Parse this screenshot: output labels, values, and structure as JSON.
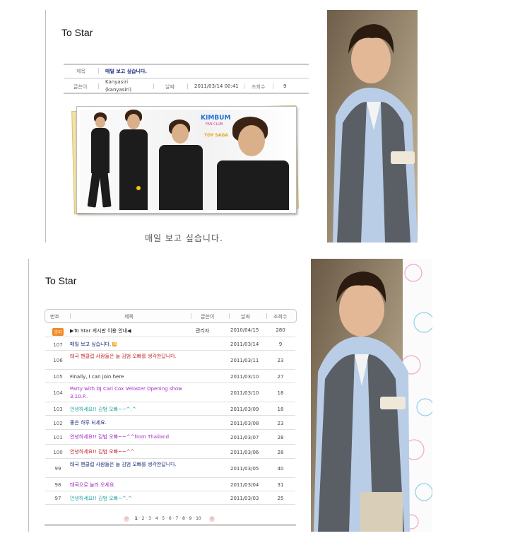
{
  "colors": {
    "subject_navy": "#1d2c7a",
    "subject_red": "#c0282d",
    "subject_purple": "#a326c2",
    "subject_teal": "#21a39c",
    "accent_orange": "#f08a24"
  },
  "top": {
    "board_title": "To Star",
    "labels": {
      "subject": "제목",
      "writer": "글쓴이",
      "date": "날짜",
      "views": "조회수"
    },
    "post": {
      "subject": "매일 보고 싶습니다.",
      "writer_line1": "Kanyasiri",
      "writer_line2": "(kanyasiri)",
      "date": "2011/03/14 00:41",
      "views": "9",
      "body": "매일 보고 싶습니다."
    },
    "banner_logo": {
      "brand": "KIMBUM",
      "line": "FAN CLUB",
      "sub": "TOY SAGA"
    }
  },
  "bottom": {
    "board_title": "To Star",
    "headers": {
      "num": "번호",
      "subject": "제목",
      "writer": "글쓴이",
      "date": "날짜",
      "views": "조회수"
    },
    "rows": [
      {
        "num": "공지",
        "subject": "▶To Star 게시판 이용 안내◀",
        "writer": "관리자",
        "date": "2010/04/15",
        "views": "280",
        "color": "#222222"
      },
      {
        "num": "107",
        "subject": "매일 보고 싶습니다.",
        "writer": "",
        "date": "2011/03/14",
        "views": "9",
        "color": "#1d2c7a"
      },
      {
        "num": "106",
        "subject": "태국 팬클럽 사람들은 늘 김범 오빠를 생각한답니다.",
        "writer": "",
        "date": "2011/03/11",
        "views": "23",
        "color": "#c0282d"
      },
      {
        "num": "105",
        "subject": "Finally, I can join here",
        "writer": "",
        "date": "2011/03/10",
        "views": "27",
        "color": "#333333"
      },
      {
        "num": "104",
        "subject": "Party with DJ Carl Cox Veloster Opening show 3.10.P..",
        "writer": "",
        "date": "2011/03/10",
        "views": "18",
        "color": "#a326c2"
      },
      {
        "num": "103",
        "subject": "안녕하세요!! 김범 오빠~~^.^",
        "writer": "",
        "date": "2011/03/09",
        "views": "18",
        "color": "#21a39c"
      },
      {
        "num": "102",
        "subject": "좋은 하루 되세요.",
        "writer": "",
        "date": "2011/03/08",
        "views": "23",
        "color": "#1d2c7a"
      },
      {
        "num": "101",
        "subject": "안녕하세요!! 김범 오빠~~^^from Thailand",
        "writer": "",
        "date": "2011/03/07",
        "views": "28",
        "color": "#a326c2"
      },
      {
        "num": "100",
        "subject": "안녕하세요!! 김범 오빠~~^^",
        "writer": "",
        "date": "2011/03/06",
        "views": "28",
        "color": "#c0282d"
      },
      {
        "num": "99",
        "subject": "태국 팬클럽 사람들은 늘 김범 오빠를 생각한답니다.",
        "writer": "",
        "date": "2011/03/05",
        "views": "40",
        "color": "#1d2c7a"
      },
      {
        "num": "98",
        "subject": "태국으로 놀러 오세요.",
        "writer": "",
        "date": "2011/03/04",
        "views": "31",
        "color": "#a326c2"
      },
      {
        "num": "97",
        "subject": "안녕하세요!! 김범 오빠~^.^",
        "writer": "",
        "date": "2011/03/03",
        "views": "25",
        "color": "#21a39c"
      }
    ],
    "pager": {
      "prev": "‹",
      "next": "›",
      "pages": [
        "1",
        "2",
        "3",
        "4",
        "5",
        "6",
        "7",
        "8",
        "9",
        "10"
      ],
      "current": "1"
    }
  }
}
